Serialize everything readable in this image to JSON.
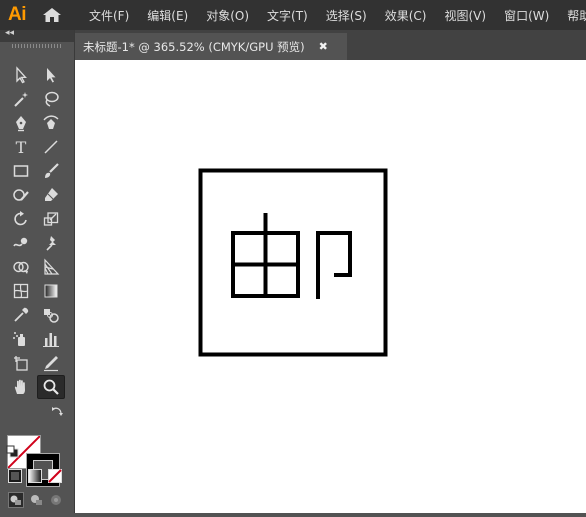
{
  "app": {
    "logo": "Ai"
  },
  "menu": [
    "文件(F)",
    "编辑(E)",
    "对象(O)",
    "文字(T)",
    "选择(S)",
    "效果(C)",
    "视图(V)",
    "窗口(W)",
    "帮助(H)"
  ],
  "tools_panel": {
    "collapse_glyph": "◂◂"
  },
  "document": {
    "tab_label": "未标题-1* @ 365.52% (CMYK/GPU 预览)",
    "close_glyph": "✖"
  },
  "colors": {
    "logo": "#ff9a00",
    "menubar": "#323232",
    "panel": "#535353",
    "canvas": "#ffffff",
    "none_slash": "#d0021b"
  },
  "icons": [
    "home-icon",
    "selection-tool-icon",
    "direct-selection-tool-icon",
    "magic-wand-icon",
    "lasso-icon",
    "pen-tool-icon",
    "curvature-tool-icon",
    "type-tool-icon",
    "line-tool-icon",
    "rectangle-tool-icon",
    "paintbrush-tool-icon",
    "shaper-tool-icon",
    "eraser-tool-icon",
    "rotate-tool-icon",
    "scale-tool-icon",
    "warp-tool-icon",
    "puppet-warp-icon",
    "shape-builder-icon",
    "perspective-grid-icon",
    "mesh-tool-icon",
    "gradient-tool-icon",
    "eyedropper-icon",
    "blend-tool-icon",
    "symbol-sprayer-icon",
    "graph-tool-icon",
    "artboard-tool-icon",
    "slice-tool-icon",
    "hand-tool-icon",
    "zoom-tool-icon"
  ]
}
